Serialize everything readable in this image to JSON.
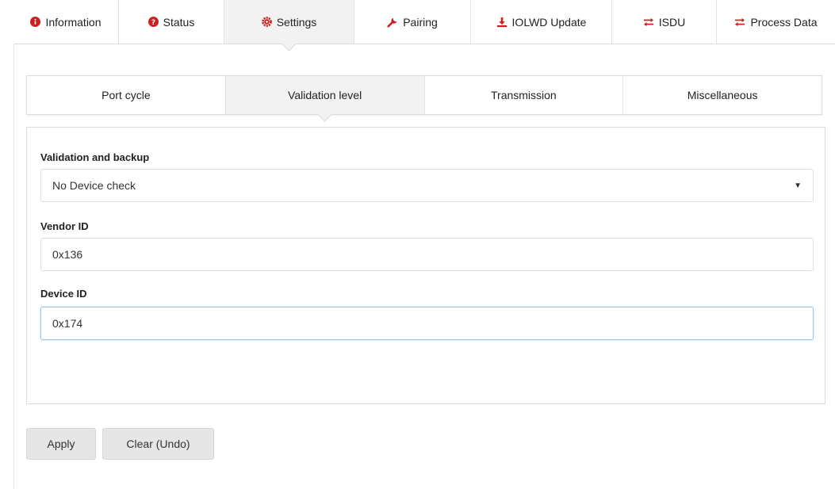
{
  "top_tabs": [
    {
      "label": "Information",
      "icon": "info-circle-icon"
    },
    {
      "label": "Status",
      "icon": "question-circle-icon"
    },
    {
      "label": "Settings",
      "icon": "gear-icon",
      "active": true
    },
    {
      "label": "Pairing",
      "icon": "wrench-icon"
    },
    {
      "label": "IOLWD Update",
      "icon": "download-icon"
    },
    {
      "label": "ISDU",
      "icon": "exchange-icon"
    },
    {
      "label": "Process Data",
      "icon": "exchange-icon"
    }
  ],
  "sub_tabs": [
    {
      "label": "Port cycle"
    },
    {
      "label": "Validation level",
      "active": true
    },
    {
      "label": "Transmission"
    },
    {
      "label": "Miscellaneous"
    }
  ],
  "form": {
    "validation": {
      "label": "Validation and backup",
      "value": "No Device check"
    },
    "vendor": {
      "label": "Vendor ID",
      "value": "0x136"
    },
    "device": {
      "label": "Device ID",
      "value": "0x174"
    }
  },
  "buttons": {
    "apply": "Apply",
    "clear": "Clear (Undo)"
  },
  "colors": {
    "icon_accent": "#cc1f1f",
    "active_tab_bg": "#f2f2f2",
    "focus_border": "#9cc6e6"
  }
}
